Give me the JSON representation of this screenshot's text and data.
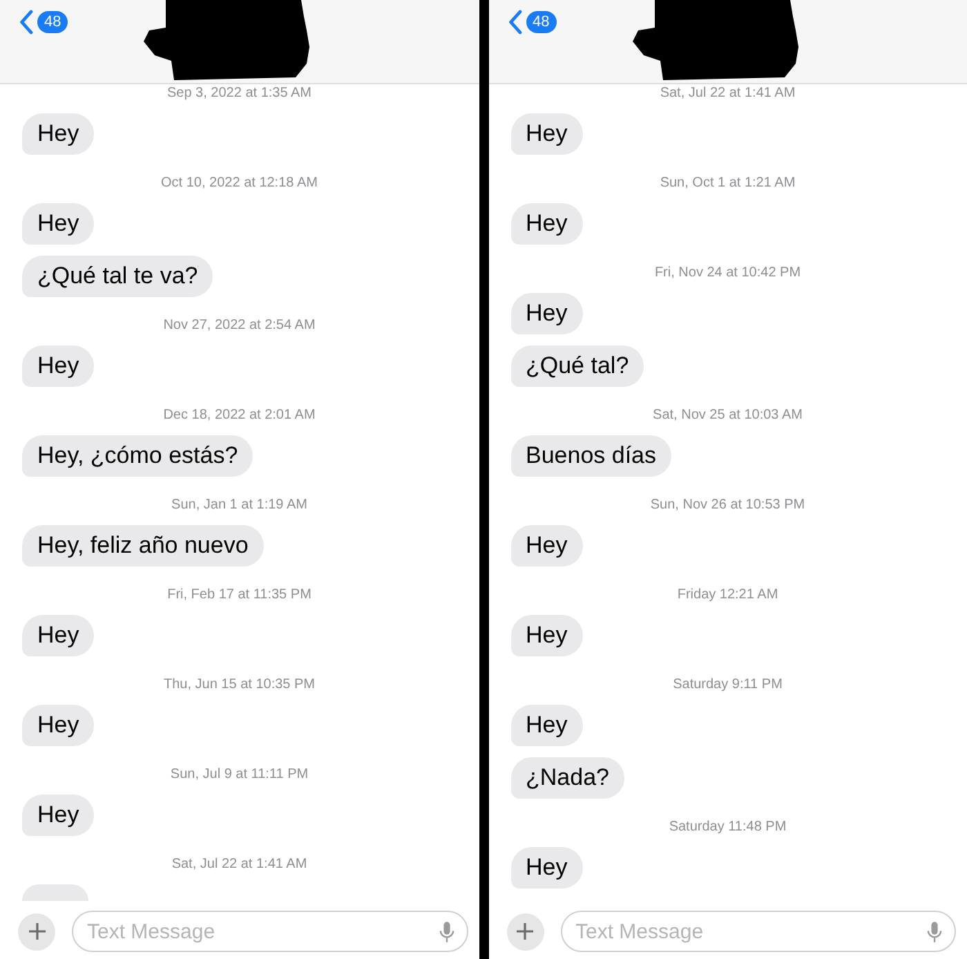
{
  "panels": [
    {
      "back_badge": "48",
      "composer": {
        "placeholder": "Text Message"
      },
      "items": [
        {
          "kind": "timestamp",
          "text": "Sep 3, 2022 at 1:35 AM"
        },
        {
          "kind": "message",
          "text": "Hey"
        },
        {
          "kind": "timestamp",
          "text": "Oct 10, 2022 at 12:18 AM"
        },
        {
          "kind": "message",
          "text": "Hey"
        },
        {
          "kind": "message",
          "text": "¿Qué tal te va?"
        },
        {
          "kind": "timestamp",
          "text": "Nov 27, 2022 at 2:54 AM"
        },
        {
          "kind": "message",
          "text": "Hey"
        },
        {
          "kind": "timestamp",
          "text": "Dec 18, 2022 at 2:01 AM"
        },
        {
          "kind": "message",
          "text": "Hey, ¿cómo estás?"
        },
        {
          "kind": "timestamp",
          "text": "Sun, Jan 1 at 1:19 AM"
        },
        {
          "kind": "message",
          "text": "Hey, feliz año nuevo"
        },
        {
          "kind": "timestamp",
          "text": "Fri, Feb 17 at 11:35 PM"
        },
        {
          "kind": "message",
          "text": "Hey"
        },
        {
          "kind": "timestamp",
          "text": "Thu, Jun 15 at 10:35 PM"
        },
        {
          "kind": "message",
          "text": "Hey"
        },
        {
          "kind": "timestamp",
          "text": "Sun, Jul 9 at 11:11 PM"
        },
        {
          "kind": "message",
          "text": "Hey"
        },
        {
          "kind": "timestamp",
          "text": "Sat, Jul 22 at 1:41 AM"
        },
        {
          "kind": "partial_message"
        }
      ]
    },
    {
      "back_badge": "48",
      "composer": {
        "placeholder": "Text Message"
      },
      "items": [
        {
          "kind": "timestamp",
          "text": "Sat, Jul 22 at 1:41 AM"
        },
        {
          "kind": "message",
          "text": "Hey"
        },
        {
          "kind": "timestamp",
          "text": "Sun, Oct 1 at 1:21 AM"
        },
        {
          "kind": "message",
          "text": "Hey"
        },
        {
          "kind": "timestamp",
          "text": "Fri, Nov 24 at 10:42 PM"
        },
        {
          "kind": "message",
          "text": "Hey"
        },
        {
          "kind": "message",
          "text": "¿Qué tal?"
        },
        {
          "kind": "timestamp",
          "text": "Sat, Nov 25 at 10:03 AM"
        },
        {
          "kind": "message",
          "text": "Buenos días"
        },
        {
          "kind": "timestamp",
          "text": "Sun, Nov 26 at 10:53 PM"
        },
        {
          "kind": "message",
          "text": "Hey"
        },
        {
          "kind": "timestamp",
          "text": "Friday 12:21 AM"
        },
        {
          "kind": "message",
          "text": "Hey"
        },
        {
          "kind": "timestamp",
          "text": "Saturday 9:11 PM"
        },
        {
          "kind": "message",
          "text": "Hey"
        },
        {
          "kind": "message",
          "text": "¿Nada?"
        },
        {
          "kind": "timestamp",
          "text": "Saturday 11:48 PM"
        },
        {
          "kind": "message",
          "text": "Hey"
        }
      ]
    }
  ]
}
